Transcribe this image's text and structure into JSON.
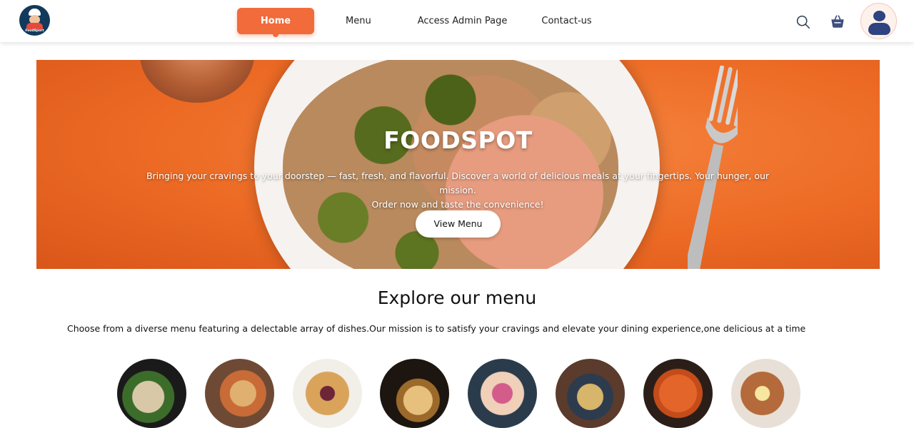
{
  "header": {
    "logo_text": "FoodSport",
    "nav": {
      "home": "Home",
      "menu": "Menu",
      "admin": "Access Admin Page",
      "contact": "Contact-us"
    },
    "icons": [
      "search-icon",
      "cart-icon",
      "profile-avatar-icon"
    ],
    "accent_color": "#f26b3a"
  },
  "hero": {
    "title": "FOODSPOT",
    "description_line1": "Bringing your cravings to your doorstep — fast, fresh, and flavorful. Discover a world of delicious meals at your fingertips. Your hunger, our mission.",
    "description_line2": "Order now and taste the convenience!",
    "button": "View Menu"
  },
  "explore": {
    "title": "Explore our menu",
    "description": "Choose from a diverse menu featuring a delectable array of dishes.Our mission is to satisfy your cravings and elevate your dining experience,one delicious at a time"
  }
}
